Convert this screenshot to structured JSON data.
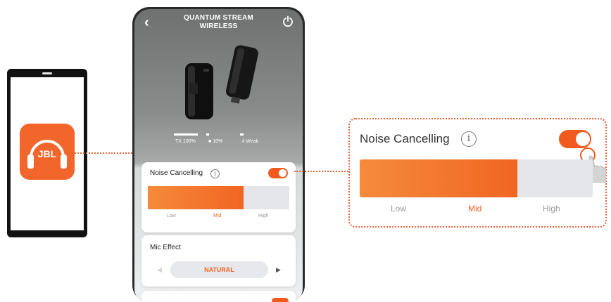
{
  "app": {
    "logo_text": "JBL",
    "brand_color": "#f26522"
  },
  "device": {
    "title_line1": "QUANTUM STREAM",
    "title_line2": "WIRELESS",
    "back_icon": "chevron-left-icon",
    "power_icon": "power-icon",
    "stats": [
      {
        "label": "TX 100%",
        "level": 1.0
      },
      {
        "label": "10%",
        "level": 0.1
      },
      {
        "label": "Weak",
        "level": 0.15
      }
    ]
  },
  "noise_cancelling": {
    "title": "Noise Cancelling",
    "info_icon": "i",
    "enabled": true,
    "levels": [
      "Low",
      "Mid",
      "High"
    ],
    "selected": "Mid",
    "fill_fraction": 0.667
  },
  "mic_effect": {
    "title": "Mic Effect",
    "preset": "NATURAL",
    "prev_icon": "◀",
    "next_icon": "▶"
  },
  "zoom": {
    "title": "Noise Cancelling",
    "info_icon": "i",
    "levels": [
      "Low",
      "Mid",
      "High"
    ]
  }
}
